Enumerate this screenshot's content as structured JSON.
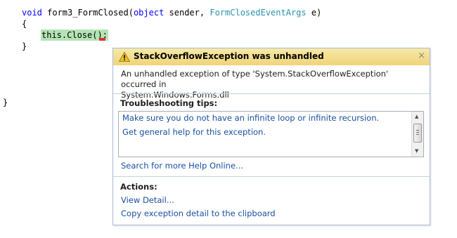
{
  "editor": {
    "line1": {
      "kw": "void",
      "name": " form3_FormClosed(",
      "kw2": "object",
      "arg1": " sender, ",
      "type": "FormClosedEventArgs",
      "arg2": " e)"
    },
    "line2": "{",
    "line3": "this.Close();",
    "line4": "}",
    "line5": "}"
  },
  "assistant": {
    "title": "StackOverflowException was unhandled",
    "close_symbol": "×",
    "description_line1": "An unhandled exception of type 'System.StackOverflowException' occurred in",
    "description_line2": "System.Windows.Forms.dll",
    "tips_heading": "Troubleshooting tips:",
    "tips": [
      "Make sure you do not have an infinite loop or infinite recursion.",
      "Get general help for this exception."
    ],
    "search_link": "Search for more Help Online...",
    "actions_heading": "Actions:",
    "actions": [
      "View Detail...",
      "Copy exception detail to the clipboard"
    ],
    "colors": {
      "header": "#efd479",
      "link": "#1a4fa0",
      "border": "#a9bcd6"
    }
  }
}
